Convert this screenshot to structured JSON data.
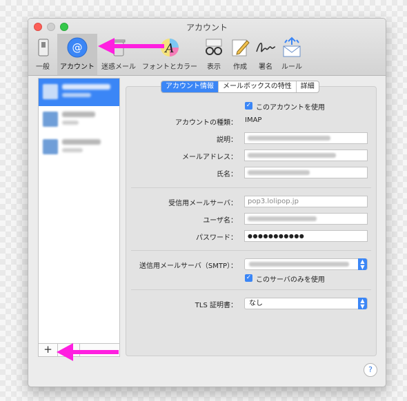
{
  "window": {
    "title": "アカウント"
  },
  "toolbar": {
    "items": [
      {
        "label": "一般",
        "icon": "switch-icon"
      },
      {
        "label": "アカウント",
        "icon": "at-sign-icon"
      },
      {
        "label": "迷惑メール",
        "icon": "trash-icon"
      },
      {
        "label": "フォントとカラー",
        "icon": "font-color-icon"
      },
      {
        "label": "表示",
        "icon": "glasses-icon"
      },
      {
        "label": "作成",
        "icon": "pencil-icon"
      },
      {
        "label": "署名",
        "icon": "signature-icon"
      },
      {
        "label": "ルール",
        "icon": "envelope-rules-icon"
      }
    ],
    "selected": "アカウント"
  },
  "tabs": {
    "account_info": "アカウント情報",
    "mailbox": "メールボックスの特性",
    "details": "詳細"
  },
  "form": {
    "enable_label": "このアカウントを使用",
    "type_label": "アカウントの種類：",
    "type_value": "IMAP",
    "description_label": "説明：",
    "email_label": "メールアドレス：",
    "name_label": "氏名：",
    "incoming_label": "受信用メールサーバ：",
    "incoming_value": "pop3.lolipop.jp",
    "username_label": "ユーザ名：",
    "password_label": "パスワード：",
    "password_value": "●●●●●●●●●●●",
    "smtp_label": "送信用メールサーバ（SMTP）：",
    "smtp_only_label": "このサーバのみを使用",
    "tls_label": "TLS 証明書：",
    "tls_value": "なし"
  },
  "list": {
    "add_label": "+"
  },
  "help_label": "?",
  "colors": {
    "accent": "#3b86f6",
    "annotation": "#ff1fe0"
  }
}
